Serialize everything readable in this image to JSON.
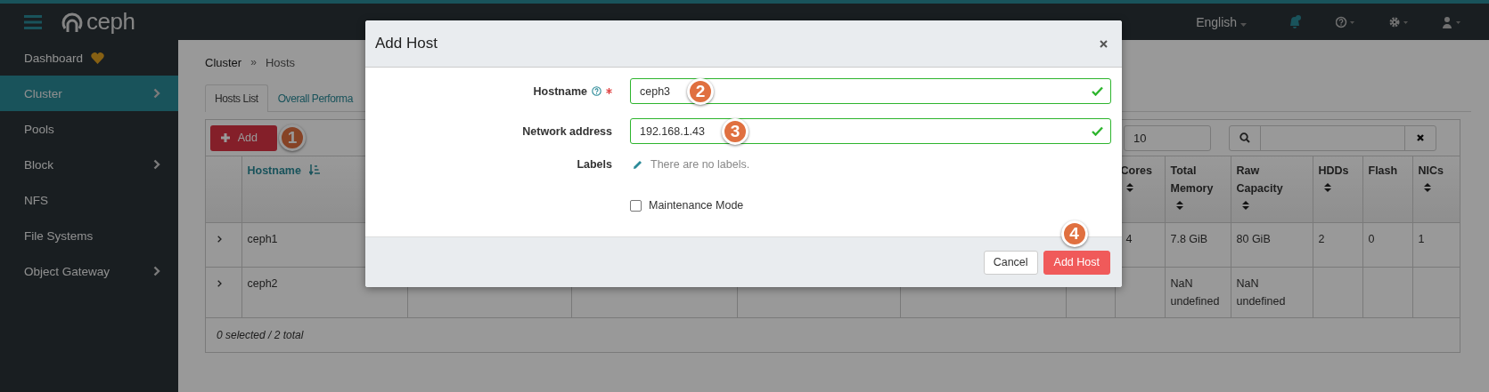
{
  "topbar": {
    "logo": "ceph",
    "language": "English"
  },
  "sidebar": {
    "items": [
      {
        "label": "Dashboard",
        "selected": false,
        "has_submenu": false,
        "status_icon": true
      },
      {
        "label": "Cluster",
        "selected": true,
        "has_submenu": true,
        "status_icon": false
      },
      {
        "label": "Pools",
        "selected": false,
        "has_submenu": false,
        "status_icon": false
      },
      {
        "label": "Block",
        "selected": false,
        "has_submenu": true,
        "status_icon": false
      },
      {
        "label": "NFS",
        "selected": false,
        "has_submenu": false,
        "status_icon": false
      },
      {
        "label": "File Systems",
        "selected": false,
        "has_submenu": false,
        "status_icon": false
      },
      {
        "label": "Object Gateway",
        "selected": false,
        "has_submenu": true,
        "status_icon": false
      }
    ]
  },
  "breadcrumb": [
    "Cluster",
    "Hosts"
  ],
  "breadcrumb_separator": "»",
  "tabs": [
    {
      "label": "Hosts List",
      "selected": true
    },
    {
      "label": "Overall Performa",
      "selected": false
    }
  ],
  "toolbar": {
    "add_button": "Add",
    "add_step": "1",
    "page_size": "10"
  },
  "table": {
    "columns": [
      {
        "label": "Hostname",
        "sortable": true,
        "sorted": true
      },
      {
        "label": "Cores",
        "sortable": true,
        "sorted": false
      },
      {
        "label": "Total Memory",
        "sortable": true,
        "sorted": false
      },
      {
        "label": "Raw Capacity",
        "sortable": true,
        "sorted": false
      },
      {
        "label": "HDDs",
        "sortable": true,
        "sorted": false
      },
      {
        "label": "Flash",
        "sortable": false,
        "sorted": false
      },
      {
        "label": "NICs",
        "sortable": true,
        "sorted": false
      }
    ],
    "rows": [
      {
        "cells": [
          "ceph1",
          "4",
          "7.8 GiB",
          "80 GiB",
          "2",
          "0",
          "1"
        ]
      },
      {
        "cells": [
          "ceph2",
          "",
          "NaN undefined",
          "NaN undefined",
          "",
          "",
          ""
        ]
      }
    ],
    "footer": "0 selected / 2 total"
  },
  "dialog": {
    "title": "Add Host",
    "fields": [
      {
        "kind": "input",
        "label": "Hostname",
        "required": true,
        "help": true,
        "value": "ceph3",
        "valid": true,
        "step": "2"
      },
      {
        "kind": "input",
        "label": "Network address",
        "required": false,
        "help": false,
        "value": "192.168.1.43",
        "valid": true,
        "step": "3"
      },
      {
        "kind": "labels",
        "label": "Labels",
        "text": "There are no labels."
      },
      {
        "kind": "checkbox",
        "label": "Maintenance Mode",
        "checked": false
      }
    ],
    "buttons": [
      {
        "label": "Cancel",
        "primary": false
      },
      {
        "label": "Add Host",
        "primary": true,
        "step": "4"
      }
    ]
  }
}
